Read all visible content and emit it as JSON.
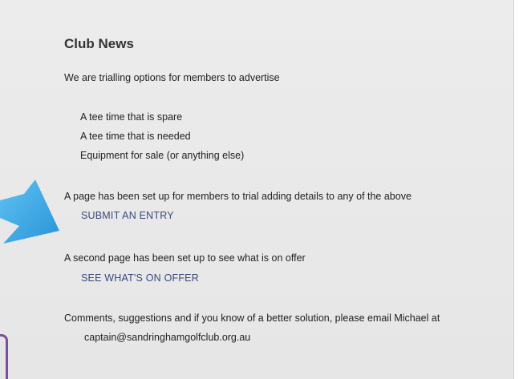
{
  "news": {
    "title": "Club News",
    "intro": "We are trialling options for members to advertise",
    "options": [
      "A tee time that is spare",
      "A tee time that is needed",
      "Equipment for sale (or anything else)"
    ],
    "submit_text": "A page has been set up for members to trial adding details to any of the above",
    "submit_link": "SUBMIT AN ENTRY",
    "offer_text": "A second page has been set up to see what is on offer",
    "offer_link": "SEE WHAT'S ON OFFER",
    "comments_text": "Comments, suggestions and if you know of a better solution, please email Michael at",
    "email": "captain@sandringhamgolfclub.org.au"
  },
  "colors": {
    "panel_bg": "#e9e9e9",
    "link": "#3a4a7a",
    "arrow": "#2e9fe0",
    "accent_mark": "#7a4fa3"
  },
  "icons": {
    "arrow": "pointing-arrow-icon"
  }
}
